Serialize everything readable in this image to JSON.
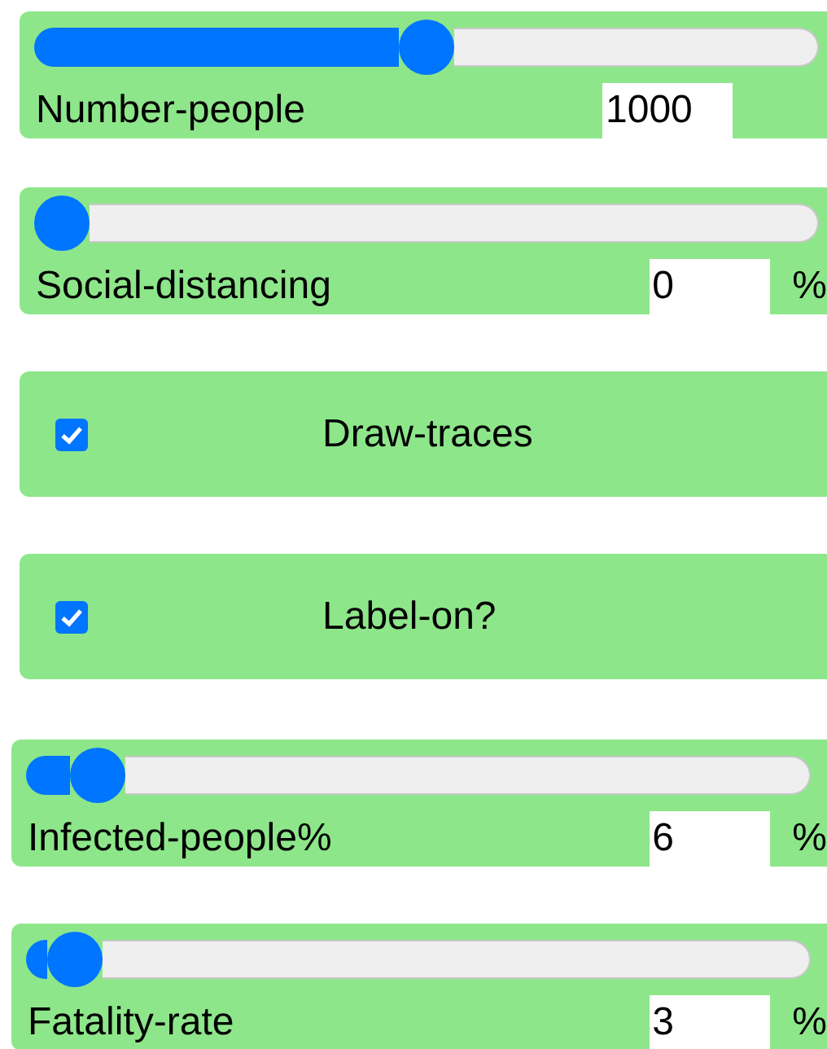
{
  "controls": [
    {
      "kind": "slider",
      "label": "Number-people",
      "level": 0.5,
      "value": "1000"
    },
    {
      "kind": "slider",
      "label": "Social-distancing",
      "level": 0,
      "value": "0",
      "unit": "%"
    },
    {
      "kind": "checkbox",
      "label": "Draw-traces",
      "checked": true
    },
    {
      "kind": "checkbox",
      "label": "Label-on?",
      "checked": true
    },
    {
      "kind": "slider",
      "label": "Infected-people%",
      "level": 0.06,
      "value": "6",
      "unit": "%"
    },
    {
      "kind": "slider",
      "label": "Fatality-rate",
      "level": 0.03,
      "value": "3",
      "unit": "%"
    }
  ]
}
